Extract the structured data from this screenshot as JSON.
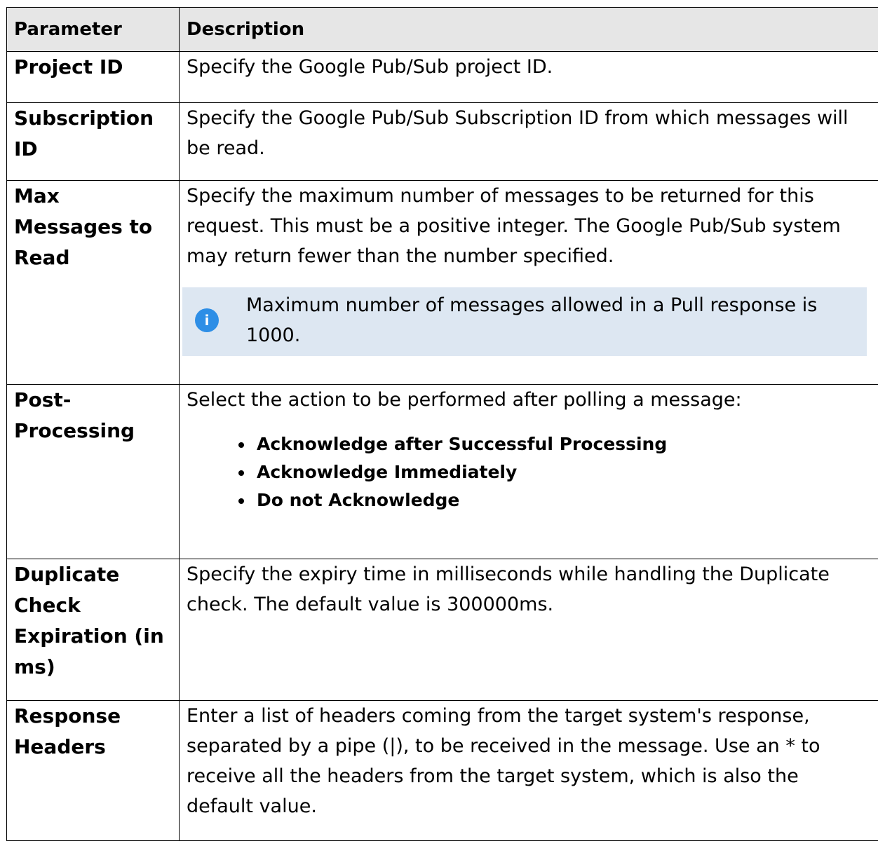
{
  "header": {
    "col_parameter": "Parameter",
    "col_description": "Description"
  },
  "rows": [
    {
      "name": "Project ID",
      "description": "Specify the Google Pub/Sub project ID."
    },
    {
      "name": "Subscription ID",
      "description": "Specify the Google Pub/Sub Subscription ID from which messages will be read."
    },
    {
      "name": "Max Messages to Read",
      "description": "Specify the maximum number of messages to be returned for this request. This must be a positive integer. The Google Pub/Sub system may return fewer than the number specified.",
      "note": "Maximum number of messages allowed in a Pull response is 1000.",
      "note_icon": "info-icon"
    },
    {
      "name": "Post-Processing",
      "description": "Select the action to be performed after polling a message:",
      "options": [
        "Acknowledge after Successful Processing",
        "Acknowledge Immediately",
        "Do not Acknowledge"
      ]
    },
    {
      "name": "Duplicate Check Expiration (in ms)",
      "description": "Specify the expiry time in milliseconds while handling the Duplicate check. The default value is 300000ms."
    },
    {
      "name": "Response Headers",
      "description": "Enter a list of headers coming from the target system's response, separated by a pipe (|), to be received in the message. Use an * to receive all the headers from the target system, which is also the default value."
    }
  ],
  "colors": {
    "header_bg": "#e6e6e6",
    "note_bg": "#dde7f2",
    "info_icon": "#2d8ee6",
    "border": "#000000"
  }
}
